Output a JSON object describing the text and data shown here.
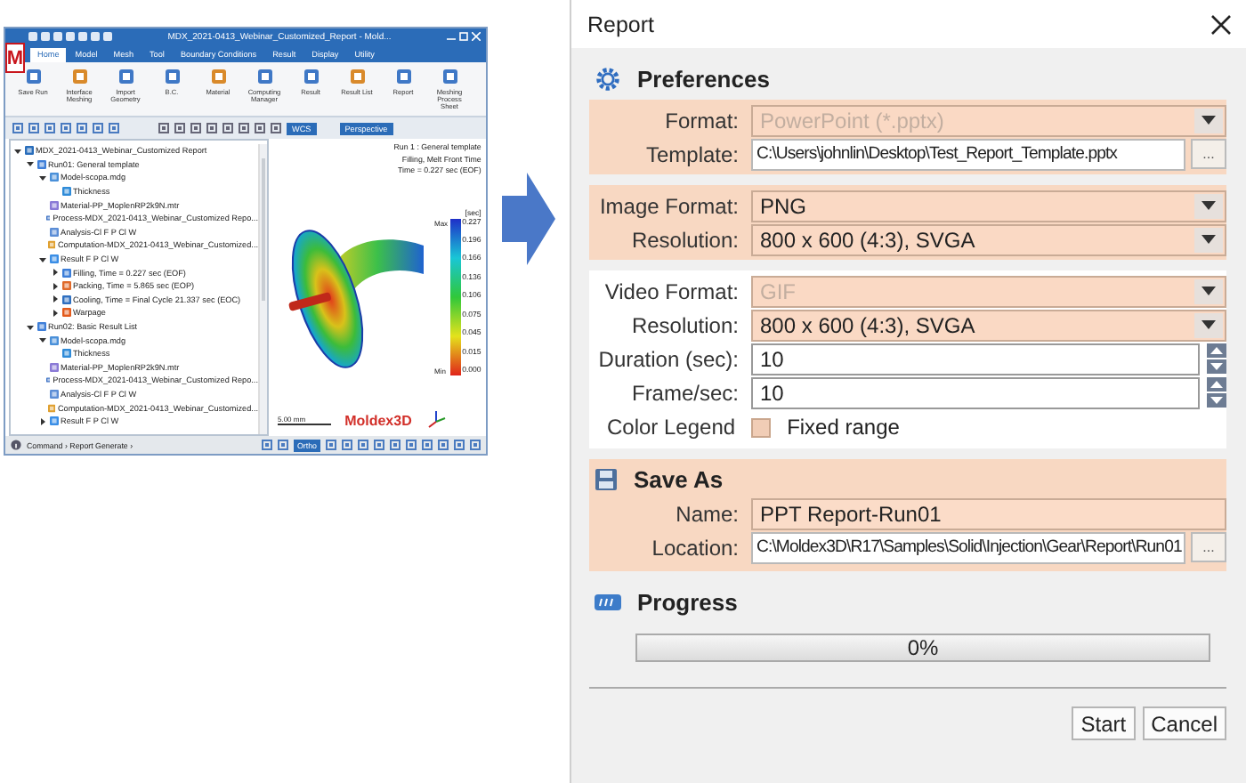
{
  "left_app": {
    "logo": "M",
    "title": "MDX_2021-0413_Webinar_Customized_Report - Mold...",
    "tabs": [
      {
        "label": "Home",
        "selected": true
      },
      {
        "label": "Model",
        "selected": false
      },
      {
        "label": "Mesh",
        "selected": false
      },
      {
        "label": "Tool",
        "selected": false
      },
      {
        "label": "Boundary Conditions",
        "selected": false
      },
      {
        "label": "Result",
        "selected": false
      },
      {
        "label": "Display",
        "selected": false
      },
      {
        "label": "Utility",
        "selected": false
      }
    ],
    "ribbon": [
      {
        "label": "Save Run"
      },
      {
        "label": "Interface Meshing"
      },
      {
        "label": "Import Geometry"
      },
      {
        "label": "B.C."
      },
      {
        "label": "Material"
      },
      {
        "label": "Computing Manager"
      },
      {
        "label": "Result"
      },
      {
        "label": "Result List"
      },
      {
        "label": "Report"
      },
      {
        "label": "Meshing Process Sheet"
      }
    ],
    "toolbar": {
      "coord_system": "WCS",
      "view": "Perspective"
    },
    "tree": [
      {
        "label": "MDX_2021-0413_Webinar_Customized Report",
        "kind": "folder",
        "expanded": true,
        "children": [
          {
            "label": "Run01: General template",
            "kind": "run",
            "expanded": true,
            "children": [
              {
                "label": "Model-scopa.mdg",
                "kind": "model",
                "expanded": true,
                "children": [
                  {
                    "label": "Thickness",
                    "kind": "layer"
                  }
                ]
              },
              {
                "label": "Material-PP_MoplenRP2k9N.mtr",
                "kind": "material"
              },
              {
                "label": "Process-MDX_2021-0413_Webinar_Customized Repo...",
                "kind": "process"
              },
              {
                "label": "Analysis-Cl F P Cl W",
                "kind": "analysis"
              },
              {
                "label": "Computation-MDX_2021-0413_Webinar_Customized...",
                "kind": "computation"
              },
              {
                "label": "Result F P Cl W",
                "kind": "result",
                "expanded": true,
                "children": [
                  {
                    "label": "Filling, Time = 0.227 sec (EOF)",
                    "kind": "filling",
                    "expanded": false
                  },
                  {
                    "label": "Packing, Time = 5.865 sec (EOP)",
                    "kind": "packing",
                    "expanded": false
                  },
                  {
                    "label": "Cooling, Time = Final Cycle 21.337 sec (EOC)",
                    "kind": "cooling",
                    "expanded": false
                  },
                  {
                    "label": "Warpage",
                    "kind": "warpage",
                    "expanded": false
                  }
                ]
              }
            ]
          },
          {
            "label": "Run02: Basic Result List",
            "kind": "run",
            "expanded": true,
            "children": [
              {
                "label": "Model-scopa.mdg",
                "kind": "model",
                "expanded": true,
                "children": [
                  {
                    "label": "Thickness",
                    "kind": "layer"
                  }
                ]
              },
              {
                "label": "Material-PP_MoplenRP2k9N.mtr",
                "kind": "material"
              },
              {
                "label": "Process-MDX_2021-0413_Webinar_Customized Repo...",
                "kind": "process"
              },
              {
                "label": "Analysis-Cl F P Cl W",
                "kind": "analysis"
              },
              {
                "label": "Computation-MDX_2021-0413_Webinar_Customized...",
                "kind": "computation"
              },
              {
                "label": "Result F P Cl W",
                "kind": "result",
                "expanded": false
              }
            ]
          }
        ]
      }
    ],
    "viewport": {
      "info": [
        "Run 1 : General template",
        "Filling, Melt Front Time",
        "Time = 0.227 sec (EOF)"
      ],
      "legend": {
        "unit": "[sec]",
        "max_label": "Max",
        "min_label": "Min",
        "ticks": [
          "0.227",
          "0.196",
          "0.166",
          "0.136",
          "0.106",
          "0.075",
          "0.045",
          "0.015",
          "0.000"
        ]
      },
      "scale": "5.00 mm",
      "brand": "Moldex3D"
    },
    "status": {
      "command": "Command › Report Generate ›",
      "ortho": {
        "label": "Ortho",
        "on": true
      }
    }
  },
  "dialog": {
    "title": "Report",
    "preferences": {
      "heading": "Preferences",
      "groups": [
        {
          "highlighted": true,
          "rows": [
            {
              "kind": "dropdown",
              "label": "Format:",
              "value": "PowerPoint (*.pptx)",
              "disabled": true
            },
            {
              "kind": "path",
              "label": "Template:",
              "value": "C:\\Users\\johnlin\\Desktop\\Test_Report_Template.pptx",
              "button": "..."
            }
          ]
        },
        {
          "highlighted": true,
          "rows": [
            {
              "kind": "dropdown",
              "label": "Image Format:",
              "value": "PNG",
              "disabled": false
            },
            {
              "kind": "dropdown",
              "label": "Resolution:",
              "value": "800 x 600 (4:3), SVGA",
              "disabled": false
            }
          ]
        },
        {
          "highlighted": false,
          "rows": [
            {
              "kind": "dropdown",
              "label": "Video Format:",
              "value": "GIF",
              "disabled": true
            },
            {
              "kind": "dropdown",
              "label": "Resolution:",
              "value": "800 x 600 (4:3), SVGA",
              "disabled": false
            },
            {
              "kind": "spinner",
              "label": "Duration (sec):",
              "value": "10"
            },
            {
              "kind": "spinner",
              "label": "Frame/sec:",
              "value": "10"
            },
            {
              "kind": "checkbox",
              "label": "Color Legend",
              "option": "Fixed range",
              "checked": false
            }
          ]
        }
      ]
    },
    "save_as": {
      "heading": "Save As",
      "rows": [
        {
          "kind": "text",
          "label": "Name:",
          "value": "PPT Report-Run01"
        },
        {
          "kind": "path",
          "label": "Location:",
          "value": "C:\\Moldex3D\\R17\\Samples\\Solid\\Injection\\Gear\\Report\\Run01",
          "button": "..."
        }
      ]
    },
    "progress": {
      "heading": "Progress",
      "level": 0,
      "reading": "0%"
    },
    "buttons": [
      {
        "label": "Start"
      },
      {
        "label": "Cancel"
      }
    ]
  }
}
